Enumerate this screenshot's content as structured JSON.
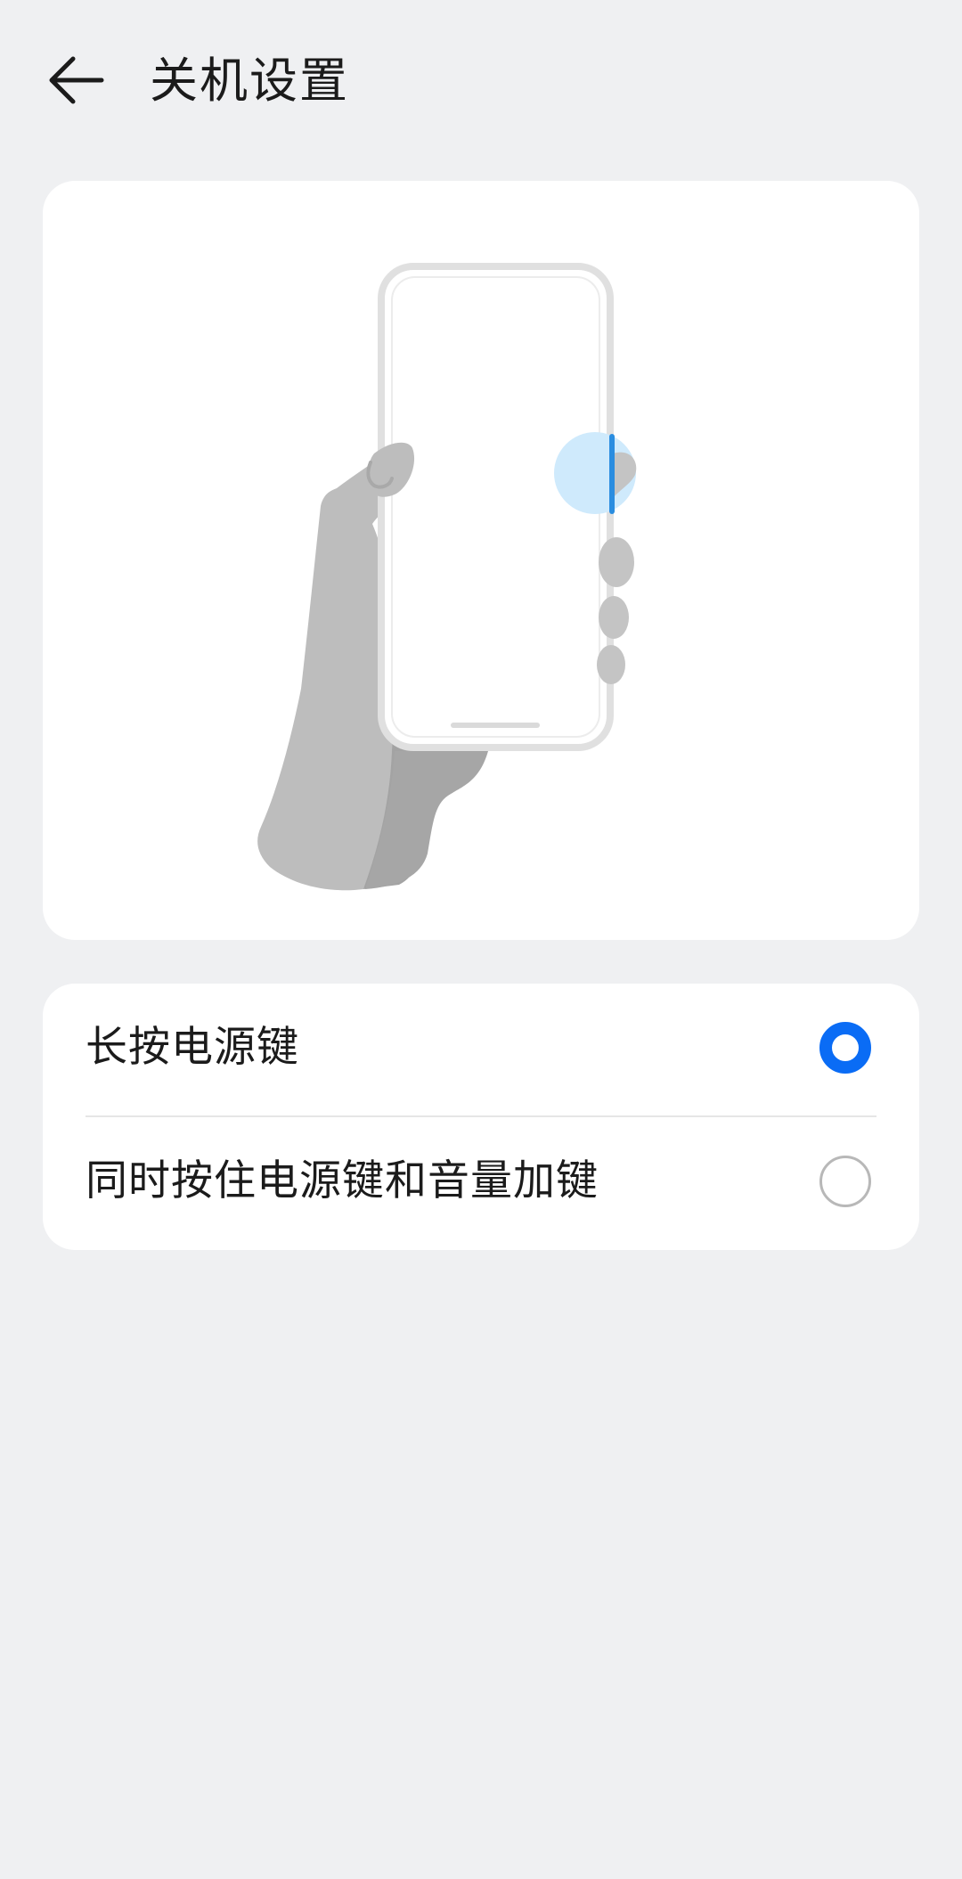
{
  "header": {
    "title": "关机设置",
    "back_icon": "arrow-left-icon"
  },
  "illustration": {
    "description_icon": "hand-holding-phone-illustration",
    "highlight_color": "#cfeafc",
    "button_color": "#2a8de0"
  },
  "options": [
    {
      "label": "长按电源键",
      "selected": true
    },
    {
      "label": "同时按住电源键和音量加键",
      "selected": false
    }
  ],
  "colors": {
    "accent": "#0a6cf5",
    "background": "#eff0f2",
    "card": "#ffffff"
  }
}
